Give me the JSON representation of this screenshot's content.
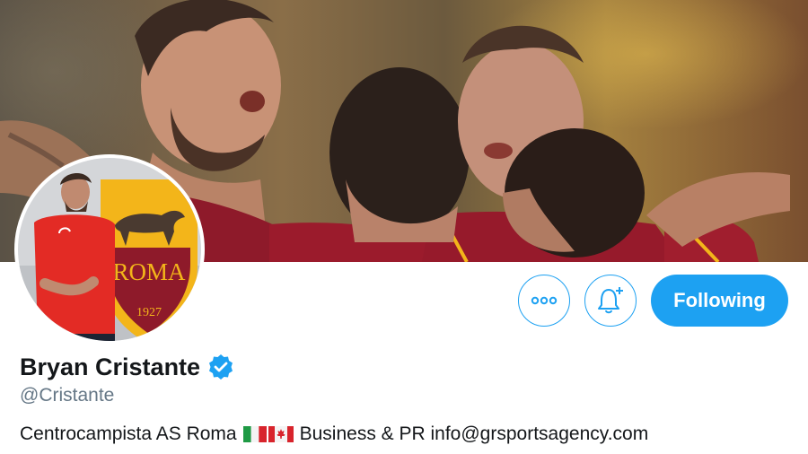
{
  "profile": {
    "display_name": "Bryan Cristante",
    "handle": "@Cristante",
    "bio_text_before": "Centrocampista AS Roma",
    "bio_text_after": "Business & PR info@grsportsagency.com",
    "bio_flags": [
      "flag-italy-icon",
      "flag-canada-icon"
    ],
    "verified": true
  },
  "avatar": {
    "crest_text": "ROMA",
    "crest_year": "1927"
  },
  "actions": {
    "more_icon": "ellipsis-icon",
    "notify_icon": "bell-plus-icon",
    "follow_label": "Following"
  },
  "colors": {
    "accent": "#1da1f2",
    "text_primary": "#14171a",
    "text_secondary": "#657786",
    "kit_red": "#9b1b2c",
    "crest_gold": "#f3b51a"
  }
}
